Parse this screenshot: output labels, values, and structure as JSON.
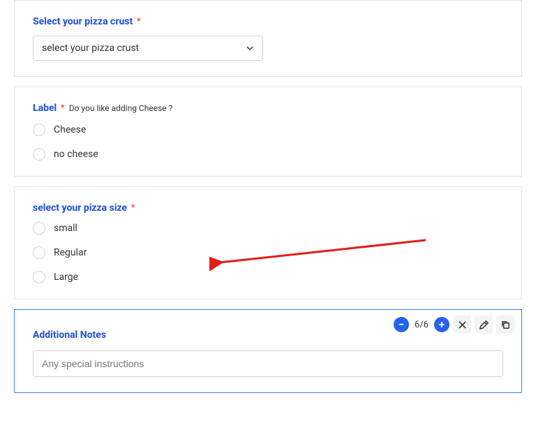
{
  "crust": {
    "label": "Select your pizza crust",
    "required_mark": "*",
    "selected": "select your pizza crust"
  },
  "cheese": {
    "label": "Label",
    "required_mark": "*",
    "helper": "Do you like adding Cheese ?",
    "options": [
      "Cheese",
      "no cheese"
    ]
  },
  "size": {
    "label": "select your pizza size",
    "required_mark": "*",
    "options": [
      "small",
      "Regular",
      "Large"
    ]
  },
  "notes": {
    "label": "Additional Notes",
    "placeholder": "Any special instructions"
  },
  "toolbar": {
    "minus": "−",
    "counter": "6/6",
    "plus": "+"
  }
}
